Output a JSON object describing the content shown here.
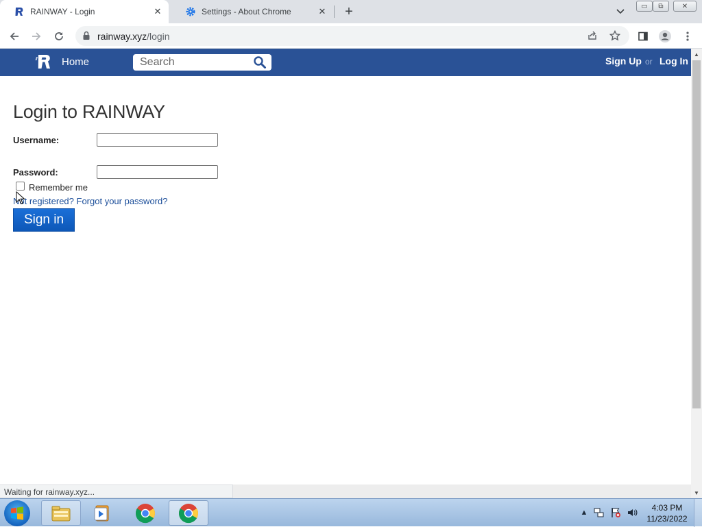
{
  "browser": {
    "tabs": [
      {
        "title": "RAINWAY - Login",
        "icon": "rainway-logo-icon",
        "active": true
      },
      {
        "title": "Settings - About Chrome",
        "icon": "settings-gear-icon",
        "active": false
      }
    ],
    "close_glyph": "✕",
    "new_tab_glyph": "+",
    "window_controls": {
      "minimize": "▭",
      "maximize": "⧉",
      "close": "✕"
    },
    "address": {
      "host": "rainway.xyz",
      "path": "/login"
    },
    "status_text": "Waiting for rainway.xyz..."
  },
  "site": {
    "brand_color": "#2a5296",
    "nav": {
      "home": "Home",
      "search_placeholder": "Search",
      "signup": "Sign Up",
      "or": "or",
      "login": "Log In"
    },
    "login": {
      "title": "Login to RAINWAY",
      "username_label": "Username:",
      "password_label": "Password:",
      "username_value": "",
      "password_value": "",
      "remember_label": "Remember me",
      "remember_checked": false,
      "not_registered": "Not registered?",
      "forgot": "Forgot your password?",
      "signin": "Sign in"
    }
  },
  "taskbar": {
    "apps": [
      "windows-explorer-icon",
      "media-player-icon",
      "chrome-icon",
      "chrome-icon"
    ],
    "clock_time": "4:03 PM",
    "clock_date": "11/23/2022",
    "tray_arrow": "▲"
  }
}
